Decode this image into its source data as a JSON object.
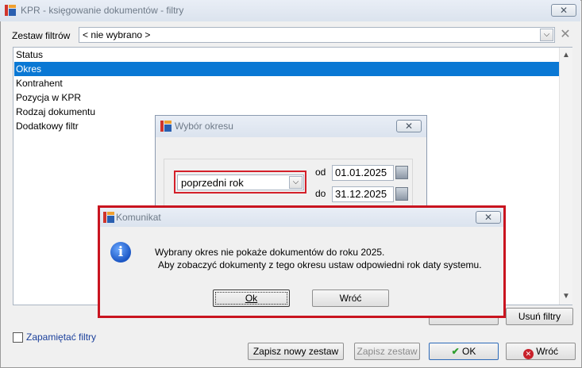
{
  "window": {
    "title": "KPR - księgowanie dokumentów - filtry",
    "close_glyph": "✕"
  },
  "filter_set": {
    "label": "Zestaw filtrów",
    "value": "< nie wybrano >"
  },
  "filter_list": {
    "items": [
      "Status",
      "Okres",
      "Kontrahent",
      "Pozycja w KPR",
      "Rodzaj dokumentu",
      "Dodatkowy filtr"
    ],
    "selected_index": 1
  },
  "buttons": {
    "remove_filters": "Usuń filtry",
    "save_new_set": "Zapisz nowy zestaw",
    "save_set": "Zapisz zestaw",
    "ok": "OK",
    "back": "Wróć"
  },
  "remember_filters": {
    "label": "Zapamiętać filtry",
    "checked": false
  },
  "period_dialog": {
    "title": "Wybór okresu",
    "period_value": "poprzedni rok",
    "from_label": "od",
    "from_value": "01.01.2025",
    "to_label": "do",
    "to_value": "31.12.2025"
  },
  "message_box": {
    "title": "Komunikat",
    "line1": "Wybrany okres nie pokaże dokumentów do roku 2025.",
    "line2": "Aby zobaczyć dokumenty z tego okresu ustaw odpowiedni rok daty systemu.",
    "ok_label": "Ok",
    "back_label": "Wróć"
  },
  "colors": {
    "selection": "#0a78d4",
    "highlight": "#d4202a"
  }
}
